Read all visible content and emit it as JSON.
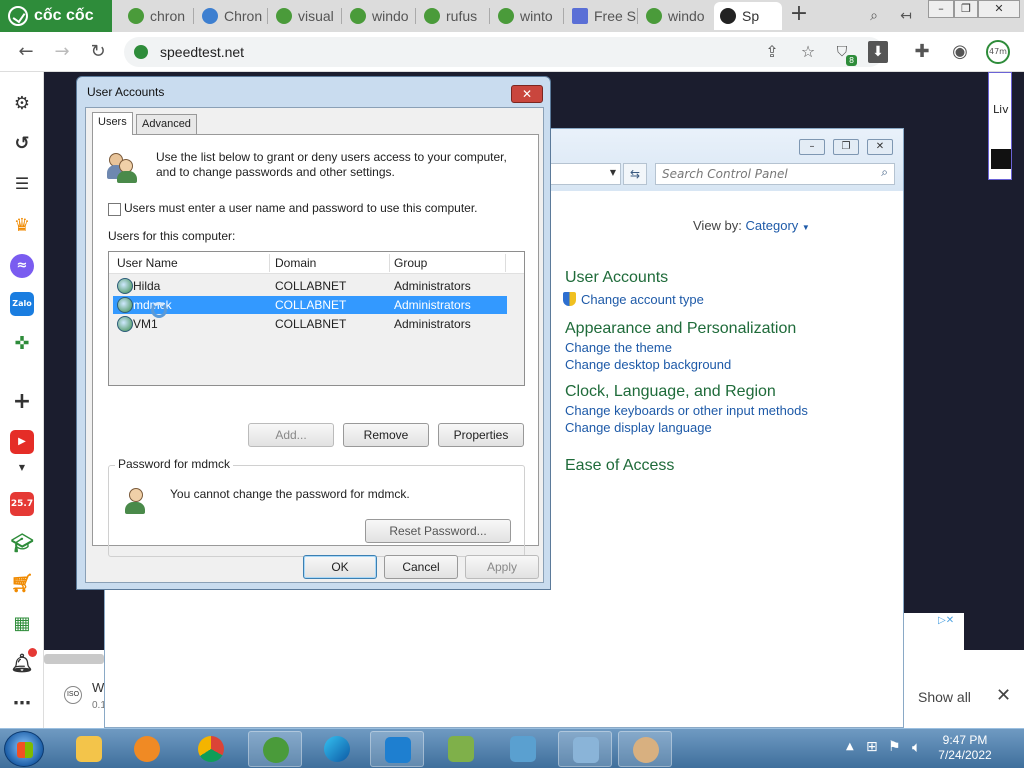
{
  "browser": {
    "brand": "cốc cốc",
    "tabs": [
      {
        "label": "chron",
        "color": "#4a9b3a"
      },
      {
        "label": "Chron",
        "color": "#3d7fd0"
      },
      {
        "label": "visual",
        "color": "#4a9b3a"
      },
      {
        "label": "windo",
        "color": "#4a9b3a"
      },
      {
        "label": "rufus",
        "color": "#4a9b3a"
      },
      {
        "label": "winto",
        "color": "#4a9b3a"
      },
      {
        "label": "Free S",
        "color": "#5a6fd6"
      },
      {
        "label": "windo",
        "color": "#4a9b3a"
      },
      {
        "label": "Sp",
        "color": "#222222"
      }
    ],
    "url": "speedtest.net",
    "timer_badge": "47m",
    "shield_count": "8"
  },
  "sidebar": {
    "badge": "25.7"
  },
  "page": {
    "ad_text": "Liv",
    "download_label": "W",
    "download_sub": "0.1",
    "show_all": "Show all"
  },
  "control_panel": {
    "search_placeholder": "Search Control Panel",
    "view_by_label": "View by:",
    "view_by_value": "Category",
    "sections": [
      {
        "heading": "User Accounts",
        "links": [
          "Change account type"
        ]
      },
      {
        "heading": "Appearance and Personalization",
        "links": [
          "Change the theme",
          "Change desktop background"
        ]
      },
      {
        "heading": "Clock, Language, and Region",
        "links": [
          "Change keyboards or other input methods",
          "Change display language"
        ]
      },
      {
        "heading": "Ease of Access",
        "links": []
      }
    ]
  },
  "user_accounts": {
    "title": "User Accounts",
    "tabs": [
      "Users",
      "Advanced"
    ],
    "intro_line1": "Use the list below to grant or deny users access to your computer,",
    "intro_line2": "and to change passwords and other settings.",
    "checkbox_label": "Users must enter a user name and password to use this computer.",
    "checkbox_checked": false,
    "list_label": "Users for this computer:",
    "columns": [
      "User Name",
      "Domain",
      "Group"
    ],
    "rows": [
      {
        "user": "Hilda",
        "domain": "COLLABNET",
        "group": "Administrators"
      },
      {
        "user": "mdmck",
        "domain": "COLLABNET",
        "group": "Administrators"
      },
      {
        "user": "VM1",
        "domain": "COLLABNET",
        "group": "Administrators"
      }
    ],
    "selected_row": 1,
    "buttons": {
      "add": "Add...",
      "remove": "Remove",
      "properties": "Properties"
    },
    "password_group": "Password for mdmck",
    "password_msg": "You cannot change the password for mdmck.",
    "reset_password": "Reset Password...",
    "ok": "OK",
    "cancel": "Cancel",
    "apply": "Apply"
  },
  "taskbar": {
    "time": "9:47 PM",
    "date": "7/24/2022"
  }
}
